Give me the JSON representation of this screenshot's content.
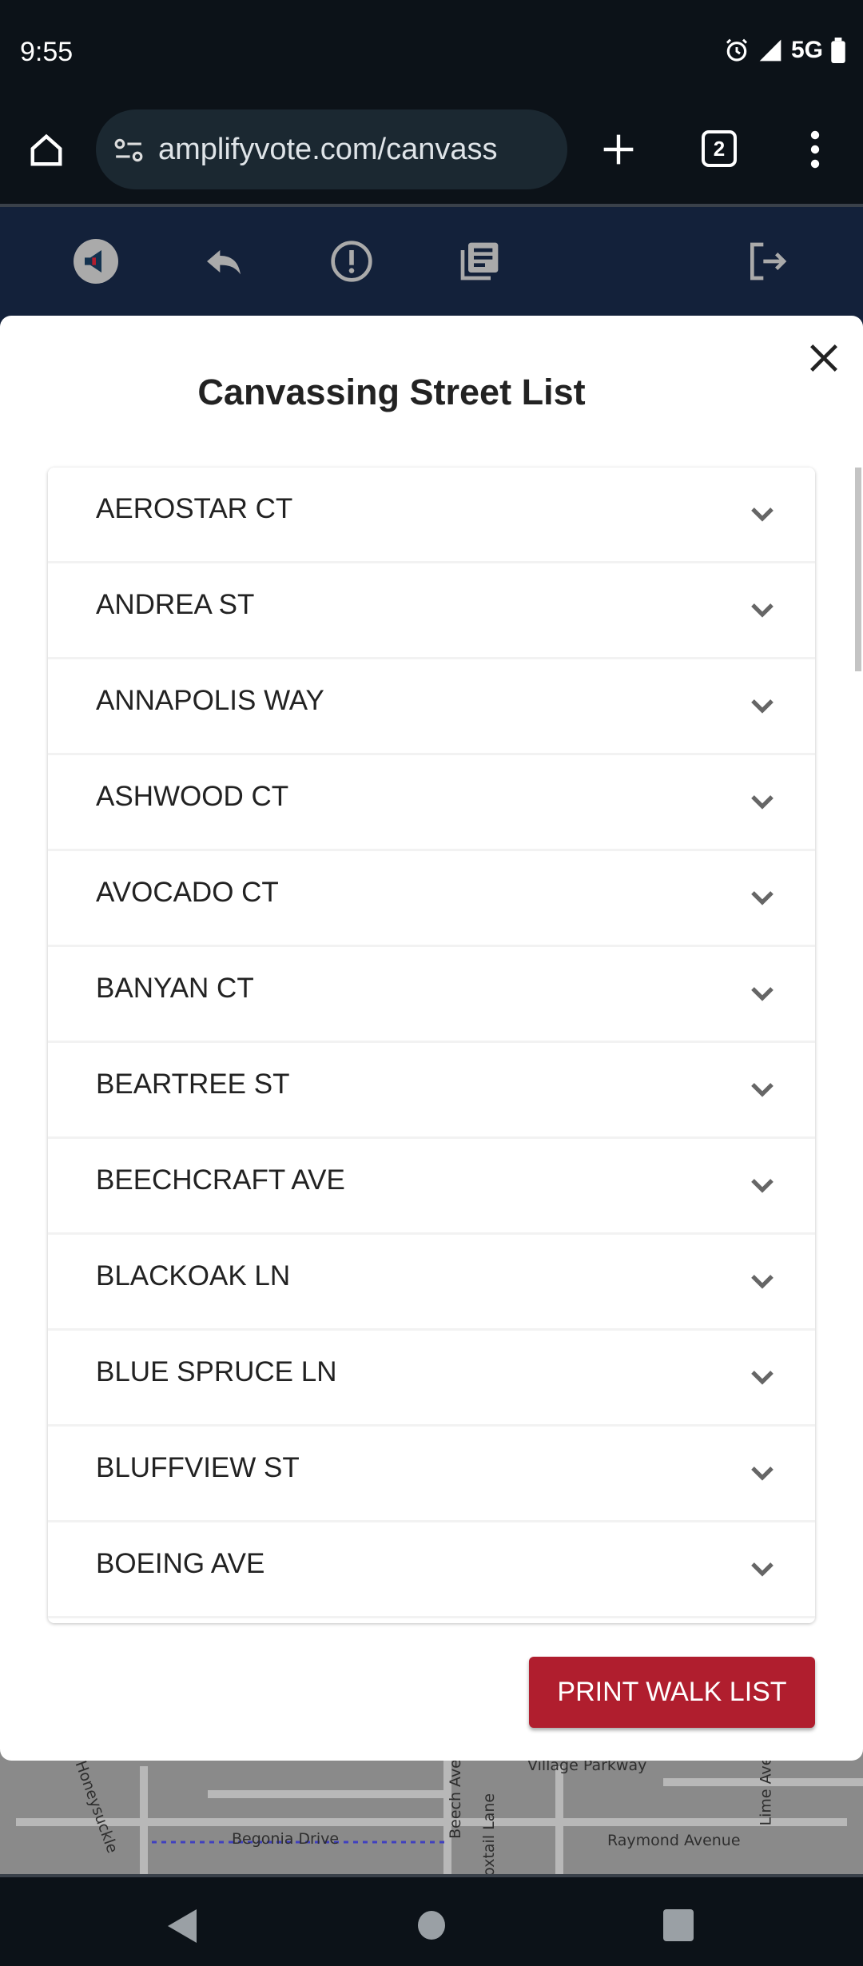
{
  "status_bar": {
    "time": "9:55",
    "network": "5G"
  },
  "browser": {
    "url": "amplifyvote.com/canvass",
    "tab_count": "2"
  },
  "map_labels": [
    "Village Parkway",
    "Begonia Drive",
    "Beech Ave",
    "Raymond Avenue",
    "Honeysuckle",
    "Lime Ave",
    "Foxtail Lane"
  ],
  "modal": {
    "title": "Canvassing Street List",
    "streets": [
      "AEROSTAR CT",
      "ANDREA ST",
      "ANNAPOLIS WAY",
      "ASHWOOD CT",
      "AVOCADO CT",
      "BANYAN CT",
      "BEARTREE ST",
      "BEECHCRAFT AVE",
      "BLACKOAK LN",
      "BLUE SPRUCE LN",
      "BLUFFVIEW ST",
      "BOEING AVE"
    ],
    "print_button": "PRINT WALK LIST"
  },
  "colors": {
    "accent": "#b01e2e",
    "header": "#13213a"
  }
}
